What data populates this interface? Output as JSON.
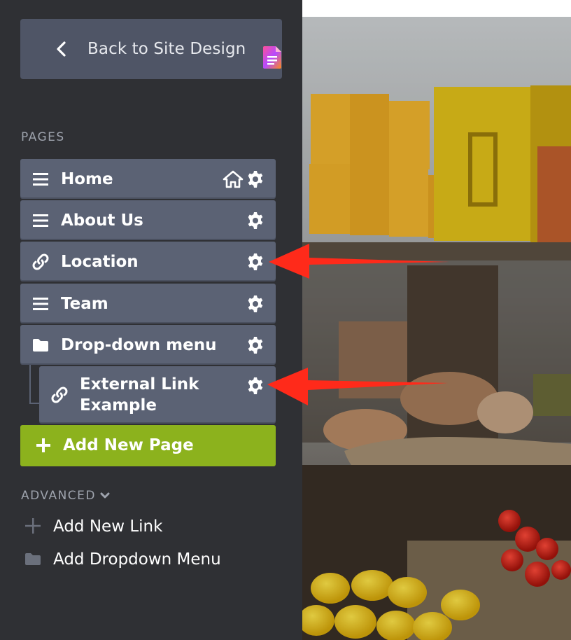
{
  "sidebar": {
    "back_label": "Back to Site Design",
    "pages_heading": "PAGES",
    "pages": [
      {
        "label": "Home",
        "icon": "menu-icon",
        "has_home": true
      },
      {
        "label": "About Us",
        "icon": "menu-icon"
      },
      {
        "label": "Location",
        "icon": "link-icon"
      },
      {
        "label": "Team",
        "icon": "menu-icon"
      },
      {
        "label": "Drop-down menu",
        "icon": "folder-icon"
      },
      {
        "label": "External Link Example",
        "icon": "link-icon",
        "child": true
      }
    ],
    "add_page_label": "Add New Page",
    "advanced_label": "ADVANCED",
    "advanced_links": [
      {
        "label": "Add New Link",
        "icon": "plus-icon"
      },
      {
        "label": "Add Dropdown Menu",
        "icon": "folder-icon"
      }
    ]
  },
  "colors": {
    "sidebar_bg": "#2f3034",
    "item_bg": "#5b6274",
    "accent_green": "#8cb21d",
    "annotation_red": "#ff2a1a"
  }
}
